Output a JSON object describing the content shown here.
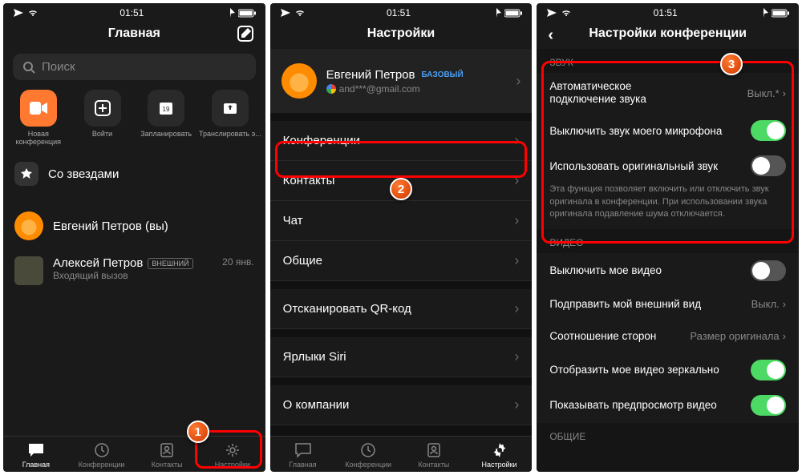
{
  "status": {
    "time": "01:51"
  },
  "screen1": {
    "title": "Главная",
    "search_placeholder": "Поиск",
    "actions": [
      {
        "label": "Новая конференция"
      },
      {
        "label": "Войти"
      },
      {
        "label": "Запланировать"
      },
      {
        "label": "Транслировать э..."
      }
    ],
    "starred": "Со звездами",
    "me": "Евгений Петров (вы)",
    "contact": {
      "name": "Алексей Петров",
      "badge": "ВНЕШНИЙ",
      "sub": "Входящий вызов",
      "date": "20 янв."
    },
    "tabs": [
      "Главная",
      "Конференции",
      "Контакты",
      "Настройки"
    ]
  },
  "screen2": {
    "title": "Настройки",
    "profile": {
      "name": "Евгений Петров",
      "plan": "БАЗОВЫЙ",
      "email": "and***@gmail.com"
    },
    "items": [
      "Конференции",
      "Контакты",
      "Чат",
      "Общие",
      "Отсканировать QR-код",
      "Ярлыки Siri",
      "О компании"
    ],
    "tabs": [
      "Главная",
      "Конференции",
      "Контакты",
      "Настройки"
    ]
  },
  "screen3": {
    "title": "Настройки конференции",
    "section_sound": "ЗВУК",
    "auto_audio": "Автоматическое подключение звука",
    "auto_audio_val": "Выкл.*",
    "mute_mic": "Выключить звук моего микрофона",
    "orig_sound": "Использовать оригинальный звук",
    "orig_hint": "Эта функция позволяет включить или отключить звук оригинала в конференции. При использовании звука оригинала подавление шума отключается.",
    "section_video": "ВИДЕО",
    "video_off": "Выключить мое видео",
    "touch_up": "Подправить мой внешний вид",
    "touch_up_val": "Выкл.",
    "aspect": "Соотношение сторон",
    "aspect_val": "Размер оригинала",
    "mirror": "Отобразить мое видео зеркально",
    "preview": "Показывать предпросмотр видео",
    "section_general": "ОБЩИЕ"
  },
  "markers": {
    "m1": "1",
    "m2": "2",
    "m3": "3"
  }
}
